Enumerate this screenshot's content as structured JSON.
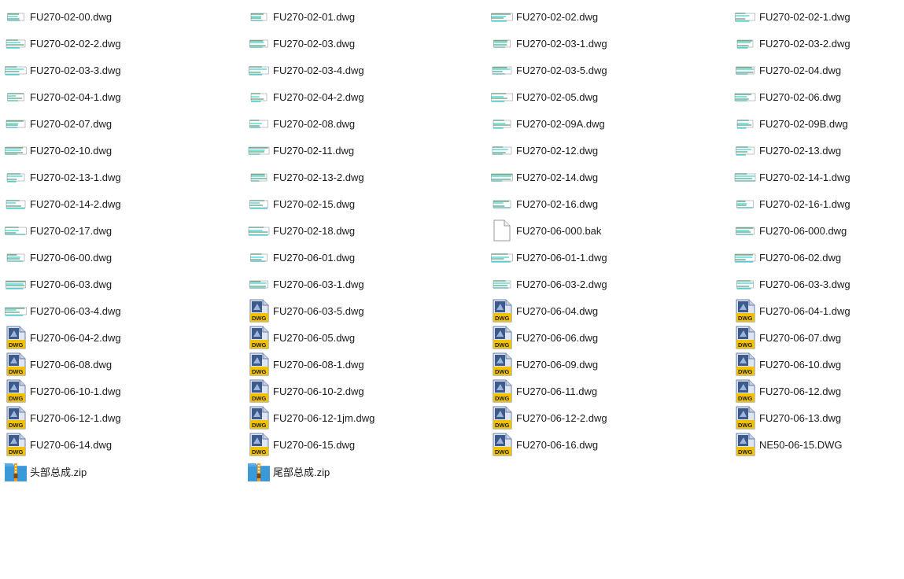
{
  "files": [
    {
      "name": "FU270-02-00.dwg",
      "icon": "drawing-thumbnail-icon"
    },
    {
      "name": "FU270-02-01.dwg",
      "icon": "drawing-thumbnail-icon"
    },
    {
      "name": "FU270-02-02.dwg",
      "icon": "drawing-thumbnail-icon"
    },
    {
      "name": "FU270-02-02-1.dwg",
      "icon": "drawing-thumbnail-icon"
    },
    {
      "name": "FU270-02-02-2.dwg",
      "icon": "drawing-thumbnail-icon"
    },
    {
      "name": "FU270-02-03.dwg",
      "icon": "drawing-thumbnail-icon"
    },
    {
      "name": "FU270-02-03-1.dwg",
      "icon": "drawing-thumbnail-icon"
    },
    {
      "name": "FU270-02-03-2.dwg",
      "icon": "drawing-thumbnail-icon"
    },
    {
      "name": "FU270-02-03-3.dwg",
      "icon": "drawing-thumbnail-icon"
    },
    {
      "name": "FU270-02-03-4.dwg",
      "icon": "drawing-thumbnail-icon"
    },
    {
      "name": "FU270-02-03-5.dwg",
      "icon": "drawing-thumbnail-icon"
    },
    {
      "name": "FU270-02-04.dwg",
      "icon": "drawing-thumbnail-icon"
    },
    {
      "name": "FU270-02-04-1.dwg",
      "icon": "drawing-thumbnail-icon"
    },
    {
      "name": "FU270-02-04-2.dwg",
      "icon": "drawing-thumbnail-icon"
    },
    {
      "name": "FU270-02-05.dwg",
      "icon": "drawing-thumbnail-icon"
    },
    {
      "name": "FU270-02-06.dwg",
      "icon": "drawing-thumbnail-icon"
    },
    {
      "name": "FU270-02-07.dwg",
      "icon": "drawing-thumbnail-icon"
    },
    {
      "name": "FU270-02-08.dwg",
      "icon": "drawing-thumbnail-icon"
    },
    {
      "name": "FU270-02-09A.dwg",
      "icon": "drawing-thumbnail-icon"
    },
    {
      "name": "FU270-02-09B.dwg",
      "icon": "drawing-thumbnail-icon"
    },
    {
      "name": "FU270-02-10.dwg",
      "icon": "drawing-thumbnail-icon"
    },
    {
      "name": "FU270-02-11.dwg",
      "icon": "drawing-thumbnail-icon"
    },
    {
      "name": "FU270-02-12.dwg",
      "icon": "drawing-thumbnail-icon"
    },
    {
      "name": "FU270-02-13.dwg",
      "icon": "drawing-thumbnail-icon"
    },
    {
      "name": "FU270-02-13-1.dwg",
      "icon": "drawing-thumbnail-icon"
    },
    {
      "name": "FU270-02-13-2.dwg",
      "icon": "drawing-thumbnail-icon"
    },
    {
      "name": "FU270-02-14.dwg",
      "icon": "drawing-thumbnail-icon"
    },
    {
      "name": "FU270-02-14-1.dwg",
      "icon": "drawing-thumbnail-icon"
    },
    {
      "name": "FU270-02-14-2.dwg",
      "icon": "drawing-thumbnail-icon"
    },
    {
      "name": "FU270-02-15.dwg",
      "icon": "drawing-thumbnail-icon"
    },
    {
      "name": "FU270-02-16.dwg",
      "icon": "drawing-thumbnail-icon"
    },
    {
      "name": "FU270-02-16-1.dwg",
      "icon": "drawing-thumbnail-icon"
    },
    {
      "name": "FU270-02-17.dwg",
      "icon": "drawing-thumbnail-icon"
    },
    {
      "name": "FU270-02-18.dwg",
      "icon": "drawing-thumbnail-icon"
    },
    {
      "name": "FU270-06-000.bak",
      "icon": "blank-file-icon"
    },
    {
      "name": "FU270-06-000.dwg",
      "icon": "drawing-thumbnail-icon"
    },
    {
      "name": "FU270-06-00.dwg",
      "icon": "drawing-thumbnail-icon"
    },
    {
      "name": "FU270-06-01.dwg",
      "icon": "drawing-thumbnail-icon"
    },
    {
      "name": "FU270-06-01-1.dwg",
      "icon": "drawing-thumbnail-icon"
    },
    {
      "name": "FU270-06-02.dwg",
      "icon": "drawing-thumbnail-icon"
    },
    {
      "name": "FU270-06-03.dwg",
      "icon": "drawing-thumbnail-icon"
    },
    {
      "name": "FU270-06-03-1.dwg",
      "icon": "drawing-thumbnail-icon"
    },
    {
      "name": "FU270-06-03-2.dwg",
      "icon": "drawing-thumbnail-icon"
    },
    {
      "name": "FU270-06-03-3.dwg",
      "icon": "drawing-thumbnail-icon"
    },
    {
      "name": "FU270-06-03-4.dwg",
      "icon": "drawing-thumbnail-icon"
    },
    {
      "name": "FU270-06-03-5.dwg",
      "icon": "dwg-file-icon"
    },
    {
      "name": "FU270-06-04.dwg",
      "icon": "dwg-file-icon"
    },
    {
      "name": "FU270-06-04-1.dwg",
      "icon": "dwg-file-icon"
    },
    {
      "name": "FU270-06-04-2.dwg",
      "icon": "dwg-file-icon"
    },
    {
      "name": "FU270-06-05.dwg",
      "icon": "dwg-file-icon"
    },
    {
      "name": "FU270-06-06.dwg",
      "icon": "dwg-file-icon"
    },
    {
      "name": "FU270-06-07.dwg",
      "icon": "dwg-file-icon"
    },
    {
      "name": "FU270-06-08.dwg",
      "icon": "dwg-file-icon"
    },
    {
      "name": "FU270-06-08-1.dwg",
      "icon": "dwg-file-icon"
    },
    {
      "name": "FU270-06-09.dwg",
      "icon": "dwg-file-icon"
    },
    {
      "name": "FU270-06-10.dwg",
      "icon": "dwg-file-icon"
    },
    {
      "name": "FU270-06-10-1.dwg",
      "icon": "dwg-file-icon"
    },
    {
      "name": "FU270-06-10-2.dwg",
      "icon": "dwg-file-icon"
    },
    {
      "name": "FU270-06-11.dwg",
      "icon": "dwg-file-icon"
    },
    {
      "name": "FU270-06-12.dwg",
      "icon": "dwg-file-icon"
    },
    {
      "name": "FU270-06-12-1.dwg",
      "icon": "dwg-file-icon"
    },
    {
      "name": "FU270-06-12-1jm.dwg",
      "icon": "dwg-file-icon"
    },
    {
      "name": "FU270-06-12-2.dwg",
      "icon": "dwg-file-icon"
    },
    {
      "name": "FU270-06-13.dwg",
      "icon": "dwg-file-icon"
    },
    {
      "name": "FU270-06-14.dwg",
      "icon": "dwg-file-icon"
    },
    {
      "name": "FU270-06-15.dwg",
      "icon": "dwg-file-icon"
    },
    {
      "name": "FU270-06-16.dwg",
      "icon": "dwg-file-icon"
    },
    {
      "name": "NE50-06-15.DWG",
      "icon": "dwg-file-icon"
    },
    {
      "name": "头部总成.zip",
      "icon": "zip-archive-icon"
    },
    {
      "name": "尾部总成.zip",
      "icon": "zip-archive-icon"
    }
  ],
  "dwg_badge": "DWG",
  "colors": {
    "thumb_line": "#2e8b57",
    "thumb_accent": "#00c8c8",
    "dwg_yellow": "#f2c200",
    "dwg_blue": "#3c5a8c",
    "zip_blue": "#3a9ad9",
    "zip_zipper": "#f0a020"
  }
}
